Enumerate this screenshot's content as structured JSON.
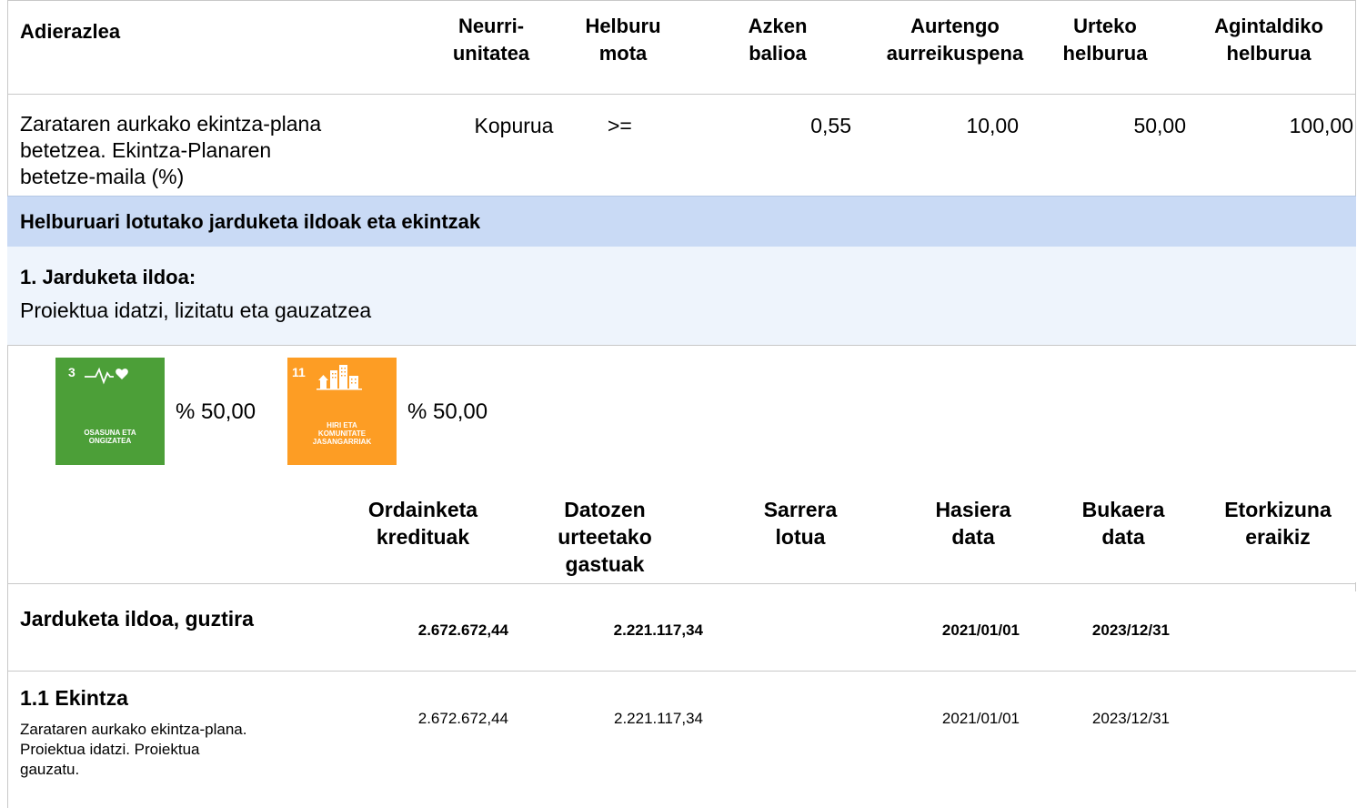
{
  "indicator_table": {
    "headers": {
      "adierazlea": "Adierazlea",
      "neurri_unitatea": [
        "Neurri-",
        "unitatea"
      ],
      "helburu_mota": [
        "Helburu",
        "mota"
      ],
      "azken_balioa": [
        "Azken",
        "balioa"
      ],
      "aurtengo": [
        "Aurtengo",
        "aurreikuspena"
      ],
      "urteko": [
        "Urteko",
        "helburua"
      ],
      "agintaldiko": [
        "Agintaldiko",
        "helburua"
      ]
    },
    "row": {
      "name_lines": [
        "Zarataren aurkako ekintza-plana",
        "betetzea. Ekintza-Planaren",
        "betetze-maila (%)"
      ],
      "unit": "Kopurua",
      "type": ">=",
      "last_value": "0,55",
      "this_year": "10,00",
      "annual": "50,00",
      "term": "100,00"
    }
  },
  "section_title": "Helburuari lotutako jarduketa ildoak eta ekintzak",
  "line": {
    "title": "1. Jarduketa ildoa:",
    "description": "Proiektua idatzi, lizitatu eta gauzatzea"
  },
  "sdgs": [
    {
      "number": "3",
      "label": [
        "OSASUNA ETA",
        "ONGIZATEA"
      ],
      "color": "#4c9f38",
      "icon": "heartbeat-icon",
      "percent": "% 50,00"
    },
    {
      "number": "11",
      "label": [
        "HIRI ETA",
        "KOMUNITATE",
        "JASANGARRIAK"
      ],
      "color": "#fd9d24",
      "icon": "city-icon",
      "percent": "% 50,00"
    }
  ],
  "budget_headers": {
    "ordainketa": [
      "Ordainketa",
      "kredituak"
    ],
    "datozen": [
      "Datozen",
      "urteetako",
      "gastuak"
    ],
    "sarrera": [
      "Sarrera",
      "lotua"
    ],
    "hasiera": [
      "Hasiera",
      "data"
    ],
    "bukaera": [
      "Bukaera",
      "data"
    ],
    "etorkizuna": [
      "Etorkizuna",
      "eraikiz"
    ]
  },
  "total_row": {
    "label": "Jarduketa ildoa, guztira",
    "ordainketa": "2.672.672,44",
    "datozen": "2.221.117,34",
    "hasiera": "2021/01/01",
    "bukaera": "2023/12/31"
  },
  "action_row": {
    "title": "1.1 Ekintza",
    "description_lines": [
      "Zarataren aurkako ekintza-plana.",
      "Proiektua idatzi. Proiektua",
      "gauzatu."
    ],
    "ordainketa": "2.672.672,44",
    "datozen": "2.221.117,34",
    "hasiera": "2021/01/01",
    "bukaera": "2023/12/31"
  },
  "colors": {
    "section_bg": "#c9daf5",
    "line_bg": "#eef4fc",
    "border": "#c8c8c8"
  }
}
